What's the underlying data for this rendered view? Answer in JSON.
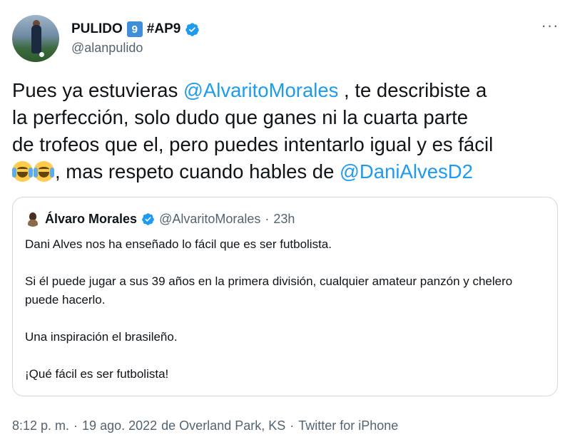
{
  "author": {
    "name": "PULIDO",
    "badge": "9",
    "tag": "#AP9",
    "handle": "@alanpulido",
    "verified_icon": "verified-badge-icon",
    "avatar_icon": "soccer-player-avatar"
  },
  "more_label": "···",
  "tweet": {
    "line1_pre": "Pues ya estuvieras ",
    "line1_mention": "@AlvaritoMorales",
    "line1_post": " , te describiste a",
    "line2": "la perfección, solo dudo que ganes ni la cuarta parte",
    "line3": "de trofeos que el, pero puedes intentarlo igual y es fácil",
    "line4_emoji": "face-with-tears-of-joy",
    "line4_pre": ", mas respeto cuando hables de ",
    "line4_mention": "@DaniAlvesD2"
  },
  "quoted": {
    "name": "Álvaro Morales",
    "handle": "@AlvaritoMorales",
    "separator": "·",
    "time": "23h",
    "paragraphs": [
      "Dani Alves nos ha enseñado lo fácil que es ser futbolista.",
      "Si él puede jugar a sus 39 años en la primera división, cualquier amateur panzón y chelero puede hacerlo.",
      "Una inspiración el brasileño.",
      "¡Qué fácil es ser futbolista!"
    ]
  },
  "meta": {
    "time": "8:12 p. m.",
    "separator": "·",
    "date": "19 ago. 2022",
    "location": "de Overland Park, KS",
    "source": "Twitter for iPhone"
  },
  "colors": {
    "link": "#1d9bf0",
    "secondary_text": "#536471",
    "primary_text": "#0f1419",
    "border": "#cfd9de",
    "badge_blue": "#3f8fd8"
  }
}
